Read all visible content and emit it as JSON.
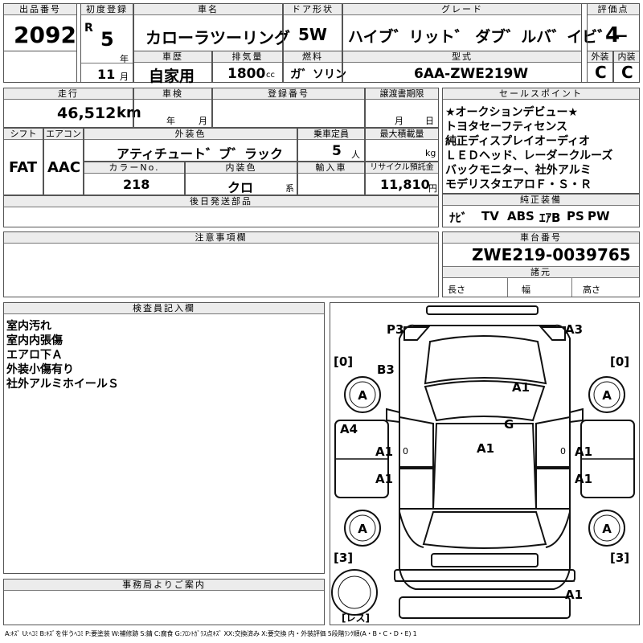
{
  "top": {
    "lot_no_label": "出品番号",
    "lot_no": "2092",
    "first_reg_label": "初度登録",
    "era": "R",
    "year_value": "5",
    "year_unit": "年",
    "month_value": "11",
    "month_unit": "月",
    "car_name_label": "車名",
    "car_name": "カローラツーリング",
    "door_label": "ドア形状",
    "door": "5W",
    "grade_label": "グレード",
    "grade": "ハイブ゛リット゛ ダブ゛ルバ゛イビ゛ー",
    "score_label": "評価点",
    "score": "4",
    "history_label": "車歴",
    "history": "自家用",
    "displacement_label": "排気量",
    "displacement": "1800",
    "displacement_unit": "cc",
    "fuel_label": "燃料",
    "fuel": "ガ゛ソリン",
    "model_label": "型式",
    "model": "6AA-ZWE219W",
    "ext_label": "外装",
    "ext_grade": "C",
    "int_label": "内装",
    "int_grade": "C"
  },
  "mid": {
    "mileage_label": "走行",
    "mileage": "46,512",
    "mileage_unit": "km",
    "inspection_label": "車検",
    "insp_year_unit": "年",
    "insp_month_unit": "月",
    "reg_no_label": "登録番号",
    "transfer_label": "譲渡書期限",
    "transfer_month": "月",
    "transfer_day": "日",
    "shift_label": "シフト",
    "shift": "FAT",
    "ac_label": "エアコン",
    "ac": "AAC",
    "ext_color_label": "外装色",
    "ext_color": "アティチュート゛ブ゛ラック",
    "capacity_label": "乗車定員",
    "capacity": "5",
    "capacity_unit": "人",
    "load_label": "最大積載量",
    "load_unit": "kg",
    "color_no_label": "カラーNo.",
    "color_no": "218",
    "int_color_label": "内装色",
    "int_color": "クロ",
    "int_color_unit": "系",
    "import_label": "輸入車",
    "recycle_label": "リサイクル預託金",
    "recycle": "11,810",
    "recycle_unit": "円",
    "later_parts_label": "後日発送部品"
  },
  "sales": {
    "label": "セールスポイント",
    "lines": [
      "★オークションデビュー★",
      "トヨタセーフティセンス",
      "純正ディスプレイオーディオ",
      "ＬＥＤヘッド、レーダークルーズ",
      "バックモニター、社外アルミ",
      "モデリスタエアロＦ・Ｓ・Ｒ"
    ]
  },
  "equipment": {
    "label": "純正装備",
    "items": [
      "ﾅﾋﾞ",
      "TV",
      "ABS",
      "ｴｱB",
      "PS",
      "PW"
    ]
  },
  "notes": {
    "label": "注意事項欄"
  },
  "chassis": {
    "label": "車台番号",
    "number": "ZWE219-0039765",
    "dims_label": "諸元",
    "length_label": "長さ",
    "width_label": "幅",
    "height_label": "高さ"
  },
  "inspector": {
    "label": "検査員記入欄",
    "lines": [
      "室内汚れ",
      "室内内張傷",
      "エアロ下Ａ",
      "外装小傷有り",
      "社外アルミホイールＳ"
    ]
  },
  "office": {
    "label": "事務局よりご案内"
  },
  "diagram": {
    "marks": {
      "p3": "P3",
      "a3_top": "A3",
      "b3": "B3",
      "a1_hood": "A1",
      "g": "G",
      "a4": "A4",
      "a1_center": "A1",
      "a1_left_front": "A1",
      "a1_left_rear": "A1",
      "a1_right_front": "A1",
      "a1_right_rear": "A1",
      "a1_bottom": "A1",
      "zero_l": "0",
      "zero_r": "0"
    },
    "wheels": {
      "lf": "A",
      "rf": "A",
      "lr": "A",
      "rr": "A"
    },
    "brackets": {
      "tl": "0",
      "tr": "0",
      "bl": "3",
      "br": "3"
    },
    "spare": "レス"
  },
  "legend": "A:ｷｽﾞ U:ﾍｺﾐ B:ｷｽﾞを伴うﾍｺﾐ P:要塗装 W:補修跡 S:錆 C:腐食 G:ﾌﾛﾝﾄｶﾞﾗｽ点ｷｽﾞ XX:交換済み X:要交換 内・外装評価 5段階ﾗﾝｸ順(A・B・C・D・E) 1"
}
